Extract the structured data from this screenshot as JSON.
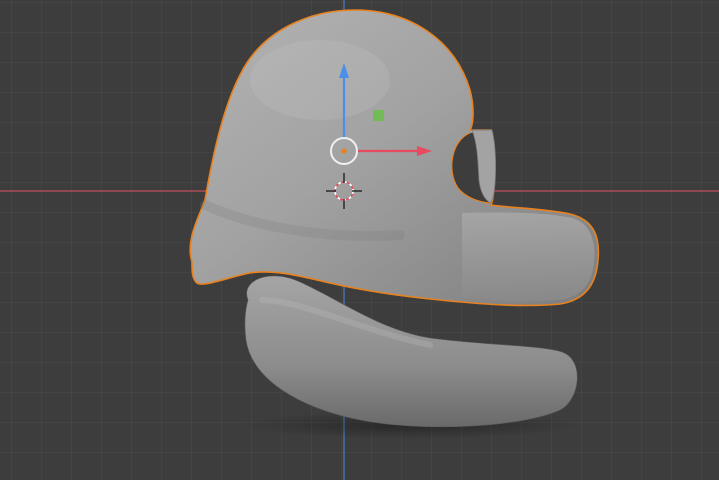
{
  "viewport": {
    "background_color": "#3d3d3d",
    "grid_color": "#4a4a4a",
    "x_axis_color": "#c24f5c",
    "z_axis_color": "#4a7fc2",
    "selection_outline_color": "#e8821f"
  },
  "object": {
    "selected": true,
    "shading": "solid",
    "base_color": "#9b9b9b"
  },
  "gizmo": {
    "type": "move",
    "x_handle_color": "#e84a5f",
    "z_handle_color": "#4a8fe8",
    "plane_handle_color": "#6bbf4a"
  },
  "cursor": {
    "name": "3d-cursor"
  }
}
